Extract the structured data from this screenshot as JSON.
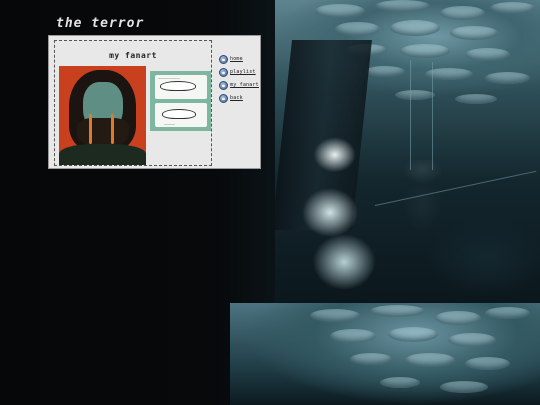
{
  "site": {
    "title": "the terror"
  },
  "panel": {
    "heading": "my fanart",
    "images": [
      {
        "name": "portrait-fanart",
        "kind": "painting"
      },
      {
        "name": "comic-fanart",
        "kind": "comic"
      }
    ]
  },
  "nav": {
    "items": [
      {
        "label": "home",
        "icon": "globe-icon"
      },
      {
        "label": "playlist",
        "icon": "globe-icon"
      },
      {
        "label": "my fanart",
        "icon": "globe-icon"
      },
      {
        "label": "back",
        "icon": "globe-icon"
      }
    ]
  },
  "colors": {
    "panel_bg": "#e8e8e8",
    "portrait_bg": "#c9401f",
    "comic_bg": "#7fb6a0",
    "nav_icon": "#4a6a9a"
  }
}
